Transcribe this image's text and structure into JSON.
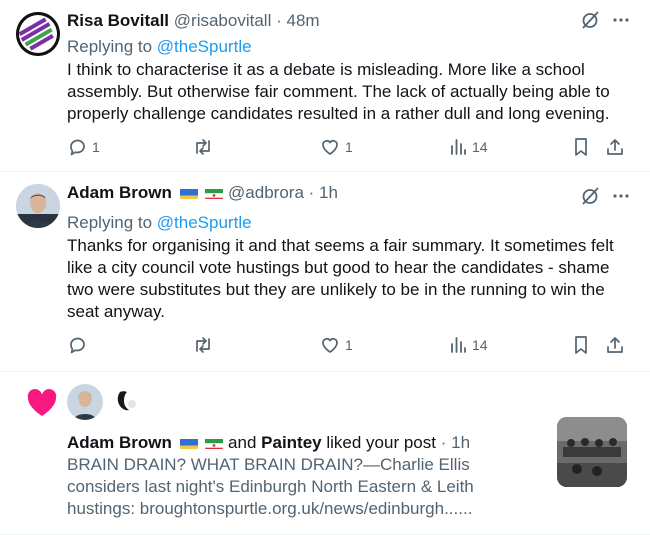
{
  "tweets": [
    {
      "name": "Risa Bovitall",
      "handle": "@risabovitall",
      "separator": "·",
      "time": "48m",
      "replying_prefix": "Replying to",
      "replying_to": "@theSpurtle",
      "text": "I think to characterise it as a debate is misleading. More like a school assembly. But otherwise fair comment. The lack of actually being able to properly challenge candidates resulted in a rather dull and long evening.",
      "reply_count": "1",
      "retweet_count": "",
      "like_count": "1",
      "view_count": "14"
    },
    {
      "name": "Adam Brown",
      "handle": "@adbrora",
      "separator": "·",
      "time": "1h",
      "replying_prefix": "Replying to",
      "replying_to": "@theSpurtle",
      "text": "Thanks for organising it and that seems a fair summary. It sometimes felt like a city council vote hustings but good to hear the candidates - shame two were substitutes but they are unlikely to be in the running to win the seat anyway.",
      "reply_count": "",
      "retweet_count": "",
      "like_count": "1",
      "view_count": "14"
    }
  ],
  "notification": {
    "user1": "Adam Brown",
    "conjunction": "and",
    "user2": "Paintey",
    "action": "liked your post",
    "separator": "·",
    "time": "1h",
    "text": "BRAIN DRAIN? WHAT BRAIN DRAIN?—Charlie Ellis considers last night's Edinburgh North Eastern & Leith hustings: broughtonspurtle.org.uk/news/edinburgh......"
  },
  "colors": {
    "text": "#0f1419",
    "muted": "#536471",
    "link": "#1d9bf0",
    "heart": "#f91880",
    "divider": "#eff3f4"
  },
  "icons": [
    "grok-icon",
    "more-icon",
    "reply-icon",
    "retweet-icon",
    "like-icon",
    "views-icon",
    "bookmark-icon",
    "share-icon",
    "heart-icon",
    "ukraine-flag-icon",
    "iran-flag-icon"
  ]
}
